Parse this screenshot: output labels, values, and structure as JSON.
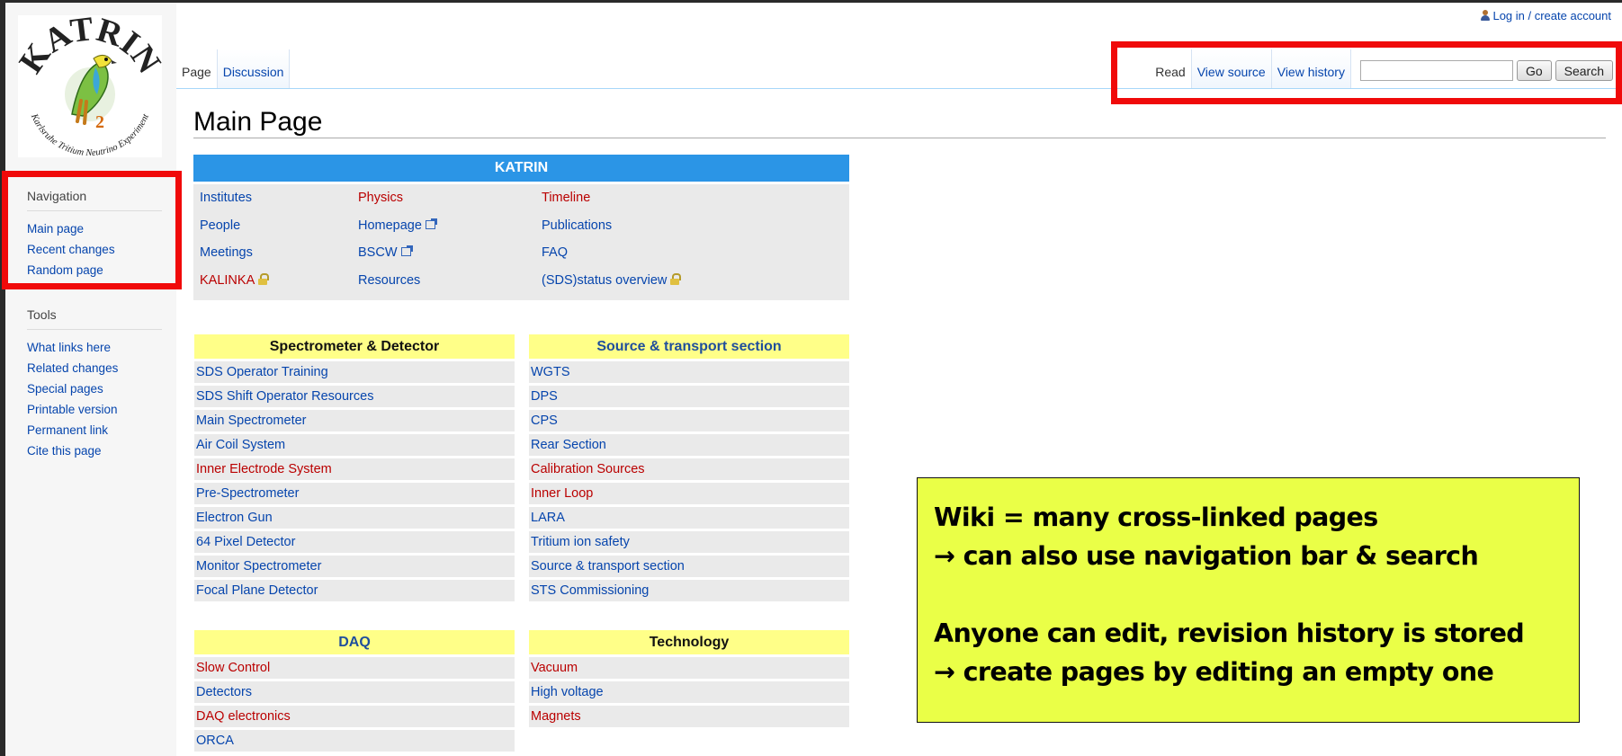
{
  "personal": {
    "login": "Log in / create account"
  },
  "logo": {
    "arc_top": "KATRIN",
    "arc_bottom": "Karlsruhe Tritium Neutrino Experiment",
    "subscript": "2"
  },
  "navigation": {
    "heading": "Navigation",
    "items": [
      "Main page",
      "Recent changes",
      "Random page"
    ]
  },
  "tools": {
    "heading": "Tools",
    "items": [
      "What links here",
      "Related changes",
      "Special pages",
      "Printable version",
      "Permanent link",
      "Cite this page"
    ]
  },
  "tabs": {
    "left": [
      "Page",
      "Discussion"
    ],
    "right": [
      "Read",
      "View source",
      "View history"
    ]
  },
  "search": {
    "value": "",
    "go_label": "Go",
    "search_label": "Search"
  },
  "page_title": "Main Page",
  "katrin_box": {
    "heading": "KATRIN",
    "columns": [
      [
        {
          "label": "Institutes",
          "color": "blue",
          "icon": ""
        },
        {
          "label": "People",
          "color": "blue",
          "icon": ""
        },
        {
          "label": "Meetings",
          "color": "blue",
          "icon": ""
        },
        {
          "label": "KALINKA",
          "color": "red",
          "icon": "lock-icon"
        }
      ],
      [
        {
          "label": "Physics",
          "color": "red",
          "icon": ""
        },
        {
          "label": "Homepage",
          "color": "blue",
          "icon": "external-link-icon"
        },
        {
          "label": "BSCW",
          "color": "blue",
          "icon": "external-link-icon"
        },
        {
          "label": "Resources",
          "color": "blue",
          "icon": ""
        }
      ],
      [
        {
          "label": "Timeline",
          "color": "red",
          "icon": ""
        },
        {
          "label": "Publications",
          "color": "blue",
          "icon": ""
        },
        {
          "label": "FAQ",
          "color": "blue",
          "icon": ""
        },
        {
          "label": "(SDS)status overview",
          "color": "blue",
          "icon": "lock-icon"
        }
      ]
    ]
  },
  "sections": {
    "spectrometer": {
      "heading": "Spectrometer & Detector",
      "heading_color": "black",
      "items": [
        {
          "label": "SDS Operator Training",
          "color": "blue"
        },
        {
          "label": "SDS Shift Operator Resources",
          "color": "blue"
        },
        {
          "label": "Main Spectrometer",
          "color": "blue"
        },
        {
          "label": "Air Coil System",
          "color": "blue"
        },
        {
          "label": "Inner Electrode System",
          "color": "red"
        },
        {
          "label": "Pre-Spectrometer",
          "color": "blue"
        },
        {
          "label": "Electron Gun",
          "color": "blue"
        },
        {
          "label": "64 Pixel Detector",
          "color": "blue"
        },
        {
          "label": "Monitor Spectrometer",
          "color": "blue"
        },
        {
          "label": "Focal Plane Detector",
          "color": "blue"
        }
      ]
    },
    "source": {
      "heading": "Source & transport section",
      "heading_color": "blue",
      "items": [
        {
          "label": "WGTS",
          "color": "blue"
        },
        {
          "label": "DPS",
          "color": "blue"
        },
        {
          "label": "CPS",
          "color": "blue"
        },
        {
          "label": "Rear Section",
          "color": "blue"
        },
        {
          "label": "Calibration Sources",
          "color": "red"
        },
        {
          "label": "Inner Loop",
          "color": "red"
        },
        {
          "label": "LARA",
          "color": "blue"
        },
        {
          "label": "Tritium ion safety",
          "color": "blue"
        },
        {
          "label": "Source & transport section",
          "color": "blue"
        },
        {
          "label": "STS Commissioning",
          "color": "blue"
        }
      ]
    },
    "daq": {
      "heading": "DAQ",
      "heading_color": "blue",
      "items": [
        {
          "label": "Slow Control",
          "color": "red"
        },
        {
          "label": "Detectors",
          "color": "blue"
        },
        {
          "label": "DAQ electronics",
          "color": "red"
        },
        {
          "label": "ORCA",
          "color": "blue"
        }
      ]
    },
    "technology": {
      "heading": "Technology",
      "heading_color": "black",
      "items": [
        {
          "label": "Vacuum",
          "color": "red"
        },
        {
          "label": "High voltage",
          "color": "blue"
        },
        {
          "label": "Magnets",
          "color": "red"
        }
      ]
    }
  },
  "callout": {
    "line1": "Wiki = many cross-linked pages",
    "line2": "→ can also use navigation bar & search",
    "line3": "Anyone can edit, revision history is stored",
    "line4": "→ create pages by editing an empty one"
  },
  "colors": {
    "link_blue": "#0645ad",
    "redlink": "#ba0000",
    "katrin_header": "#2b95e6",
    "section_header": "#ffff88",
    "highlight_box": "#f00a0a",
    "callout_bg": "#eaff47"
  }
}
